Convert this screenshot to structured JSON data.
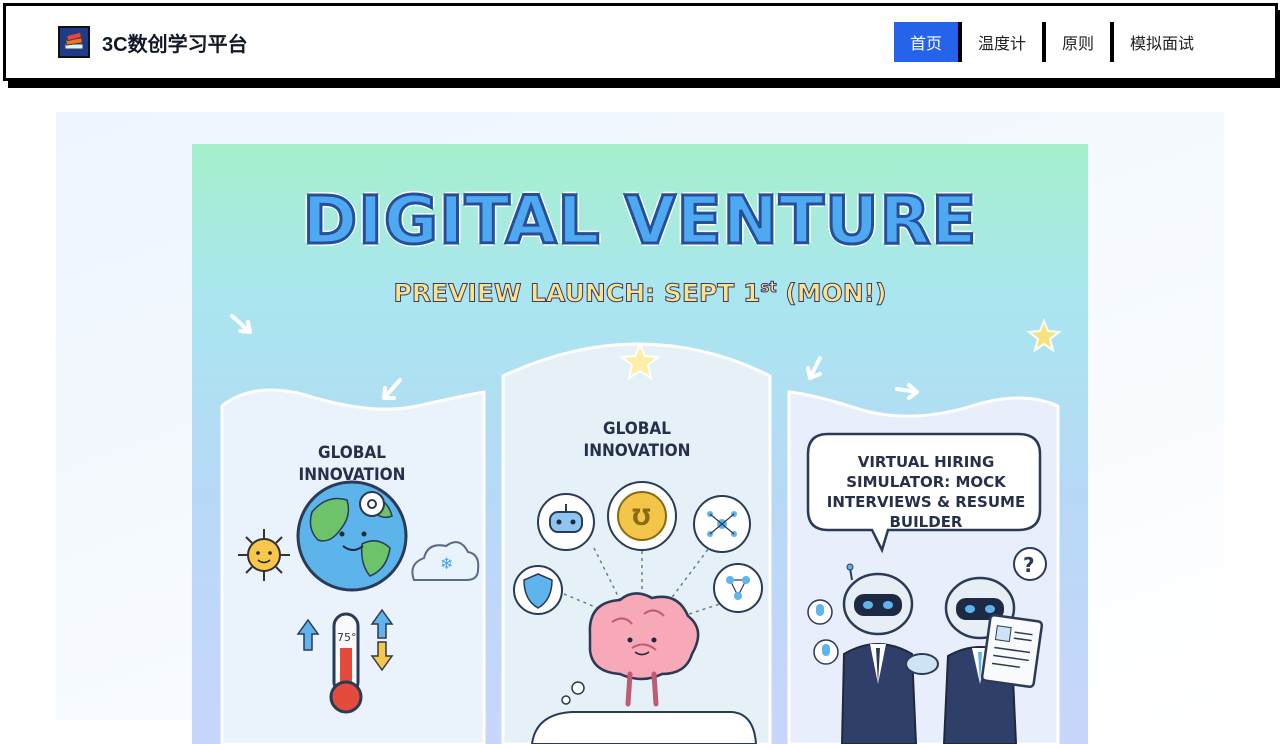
{
  "header": {
    "brand_title": "3C数创学习平台",
    "nav": [
      {
        "label": "首页",
        "active": true
      },
      {
        "label": "温度计",
        "active": false
      },
      {
        "label": "原则",
        "active": false
      },
      {
        "label": "模拟面试",
        "active": false
      }
    ]
  },
  "poster": {
    "title": "DIGITAL VENTURE",
    "subtitle_prefix": "PREVIEW LAUNCH: SEPT 1",
    "subtitle_sup": "st",
    "subtitle_suffix": " (MON!)",
    "panel_left_heading": "GLOBAL INNOVATION",
    "panel_center_heading": "GLOBAL INNOVATION",
    "panel_right_bubble": "VIRTUAL HIRING SIMULATOR: MOCK INTERVIEWS & RESUME BUILDER",
    "thermometer_label": "75°"
  },
  "colors": {
    "nav_active": "#2563eb",
    "title_fill": "#4fa9f1",
    "title_stroke": "#24509a"
  }
}
